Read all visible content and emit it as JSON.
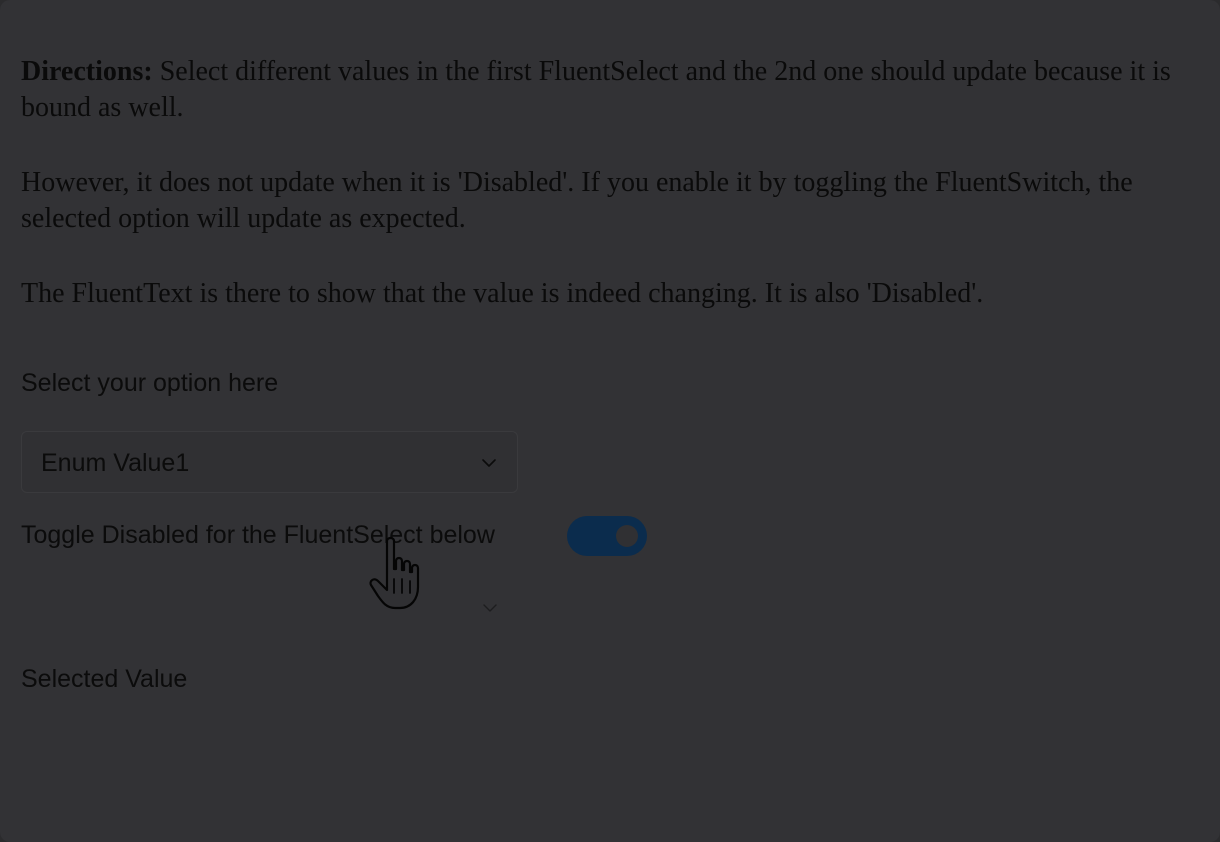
{
  "directions": {
    "label": "Directions:",
    "text": " Select different values in the first FluentSelect and the 2nd one should update because it is bound as well.",
    "paragraph2": "However, it does not update when it is 'Disabled'. If you enable it by toggling the FluentSwitch, the selected option will update as expected.",
    "paragraph3": "The FluentText is there to show that the value is indeed changing. It is also 'Disabled'."
  },
  "select1": {
    "label": "Select your option here",
    "value": "Enum Value1",
    "icon": "chevron-down-icon"
  },
  "toggle": {
    "label": "Toggle Disabled for the FluentSelect below",
    "checked": true,
    "color": "#0b2c4d"
  },
  "select2": {
    "value": "",
    "icon": "chevron-down-icon"
  },
  "selected_value": {
    "label": "Selected Value",
    "value": ""
  },
  "cursor": {
    "icon": "hand-pointer-icon"
  }
}
